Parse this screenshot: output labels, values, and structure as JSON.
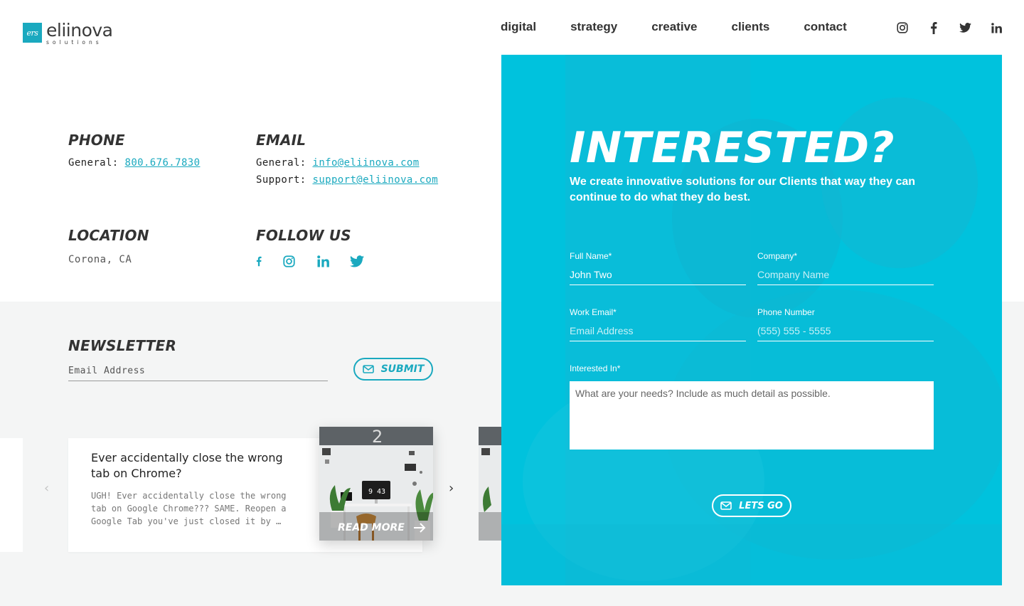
{
  "brand": {
    "logo_mark": "ers",
    "name": "eliinova",
    "tagline": "solutions",
    "accent": "#1aa9bf",
    "panel_color": "#00c2dd"
  },
  "nav": {
    "items": [
      "digital",
      "strategy",
      "creative",
      "clients",
      "contact"
    ]
  },
  "header_social": [
    "instagram-icon",
    "facebook-icon",
    "twitter-icon",
    "linkedin-icon"
  ],
  "contact": {
    "phone_heading": "PHONE",
    "phone_prefix": "General:",
    "phone": "800.676.7830",
    "email_heading": "EMAIL",
    "email_general_prefix": "General:",
    "email_general": "info@eliinova.com",
    "email_support_prefix": "Support:",
    "email_support": "support@eliinova.com",
    "location_heading": "LOCATION",
    "location": "Corona, CA",
    "follow_heading": "FOLLOW US",
    "follow_icons": [
      "facebook-icon",
      "instagram-icon",
      "linkedin-icon",
      "twitter-icon"
    ]
  },
  "newsletter": {
    "heading": "NEWSLETTER",
    "placeholder": "Email Address",
    "submit_label": "SUBMIT"
  },
  "blog": {
    "post_title": "Ever accidentally close the wrong tab on Chrome?",
    "post_excerpt": "UGH! Ever accidentally close the wrong tab on Google Chrome??? SAME. Reopen a Google Tab you've just closed it by …",
    "read_more": "READ MORE",
    "clock_text": "9 43"
  },
  "form": {
    "title": "INTERESTED?",
    "subtitle": "We create innovative solutions for our Clients that way they can continue to do what they do best.",
    "full_name_label": "Full Name*",
    "full_name_value": "John Two",
    "company_label": "Company*",
    "company_placeholder": "Company Name",
    "email_label": "Work Email*",
    "email_placeholder": "Email Address",
    "phone_label": "Phone Number",
    "phone_placeholder": "(555) 555 - 5555",
    "interest_label": "Interested In*",
    "interest_placeholder": "What are your needs? Include as much detail as possible.",
    "submit_label": "LETS GO"
  }
}
